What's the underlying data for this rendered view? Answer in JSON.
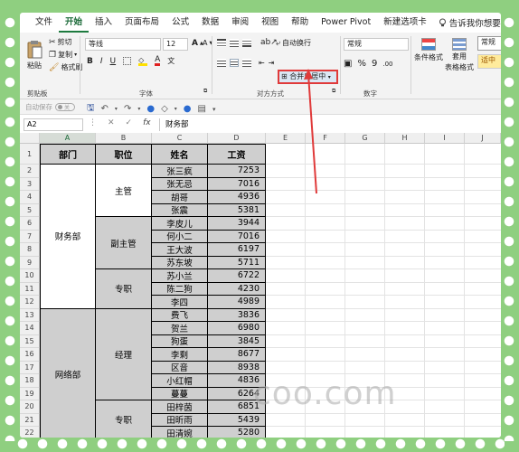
{
  "tabs": [
    "文件",
    "开始",
    "插入",
    "页面布局",
    "公式",
    "数据",
    "审阅",
    "视图",
    "帮助",
    "Power Pivot",
    "新建选项卡"
  ],
  "tell_me": "告诉我你想要做什么",
  "ribbon": {
    "paste": "粘贴",
    "cut": "剪切",
    "copy": "复制",
    "format_painter": "格式刷",
    "clipboard_label": "剪贴板",
    "font_name": "等线",
    "font_size": "12",
    "bold": "B",
    "italic": "I",
    "underline": "U",
    "font_label": "字体",
    "wrap_text": "自动换行",
    "merge_center": "合并后居中",
    "align_label": "对方方式",
    "number_format": "常规",
    "percent": "%",
    "comma": "9",
    "number_label": "数字",
    "cond_format": "条件格式",
    "table_format_1": "套用",
    "table_format_2": "表格格式",
    "style_normal": "常规",
    "style_bad": "适中"
  },
  "qat": {
    "autosave": "自动保存",
    "off": "关"
  },
  "formula_bar": {
    "name_box": "A2",
    "fx": "fx",
    "content": "财务部"
  },
  "columns": [
    "A",
    "B",
    "C",
    "D",
    "E",
    "F",
    "G",
    "H",
    "I",
    "J"
  ],
  "rows": [
    "1",
    "2",
    "3",
    "4",
    "5",
    "6",
    "7",
    "8",
    "9",
    "10",
    "11",
    "12",
    "13",
    "14",
    "15",
    "16",
    "17",
    "18",
    "19",
    "20",
    "21",
    "22"
  ],
  "table": {
    "headers": [
      "部门",
      "职位",
      "姓名",
      "工资"
    ],
    "departments": [
      "财务部",
      "网络部"
    ],
    "positions": [
      "主管",
      "副主管",
      "专职",
      "经理",
      "专职"
    ],
    "names": [
      "张三疯",
      "张无忌",
      "胡哥",
      "张震",
      "李皮儿",
      "何小二",
      "王大波",
      "苏东坡",
      "苏小兰",
      "陈二狗",
      "李四",
      "费飞",
      "贺兰",
      "狗蛋",
      "李剩",
      "区音",
      "小红帽",
      "蔓蔓",
      "田梓茵",
      "田昕雨",
      "田清婉"
    ],
    "salaries": [
      "7253",
      "7016",
      "4936",
      "5381",
      "3944",
      "7016",
      "6197",
      "5711",
      "6722",
      "4230",
      "4989",
      "3836",
      "6980",
      "3845",
      "8677",
      "8938",
      "4836",
      "6264",
      "6851",
      "5439",
      "5280"
    ]
  },
  "watermark": "coo.com",
  "colors": {
    "accent": "#1d7a3e",
    "highlight_box": "#e03a3a",
    "merged_fill": "#cfcfcf",
    "background": "#8fcf80"
  }
}
